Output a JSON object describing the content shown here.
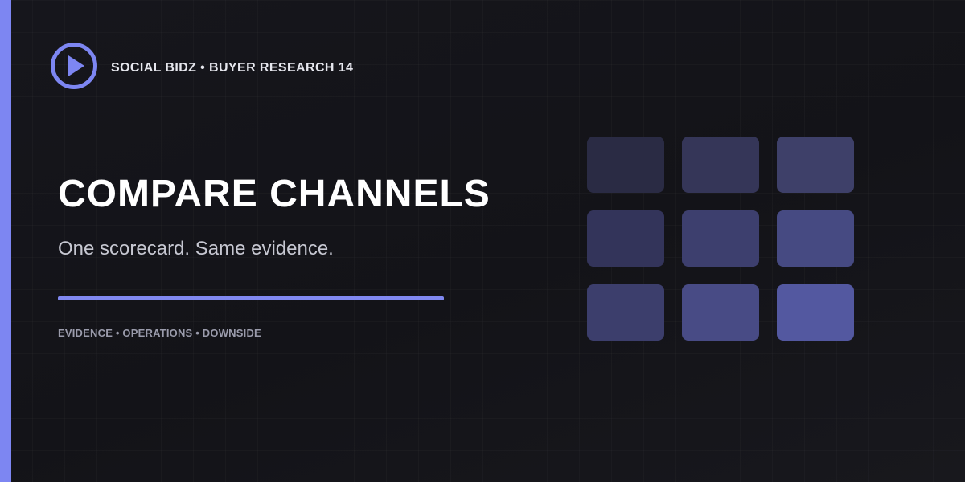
{
  "header": {
    "logo_icon": "play-circle-icon",
    "brand": "SOCIAL BIDZ • BUYER RESEARCH 14"
  },
  "hero": {
    "title": "COMPARE CHANNELS",
    "subtitle": "One scorecard. Same evidence.",
    "tags": "EVIDENCE • OPERATIONS • DOWNSIDE"
  },
  "colors": {
    "accent": "#7d86f2",
    "background": "#131318",
    "tiles": [
      "#2a2b44",
      "#353658",
      "#3e4069",
      "#33345a",
      "#3d3f6e",
      "#464a82",
      "#3c3e6c",
      "#484b85",
      "#5358a0"
    ]
  }
}
